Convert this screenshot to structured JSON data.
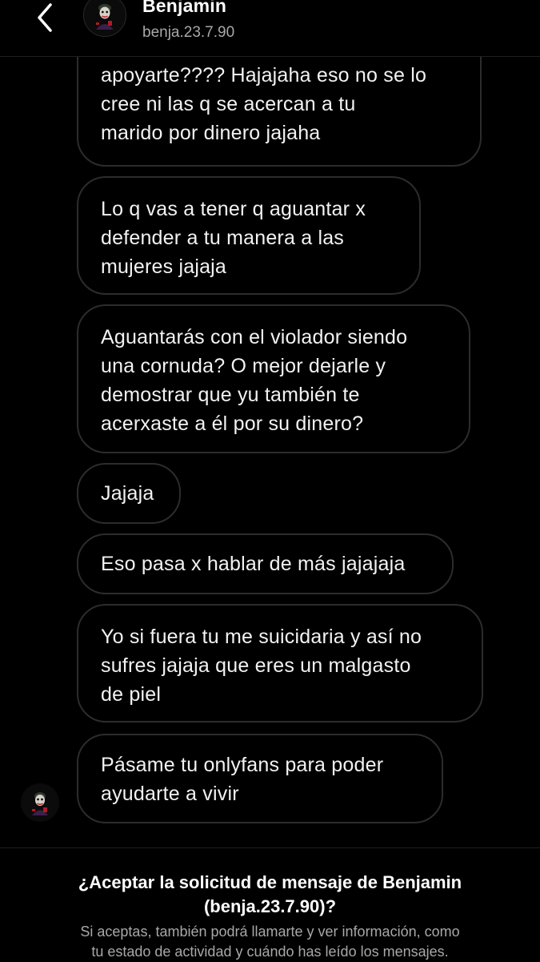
{
  "header": {
    "name": "Benjamin",
    "handle": "benja.23.7.90",
    "back_icon": "chevron-left-icon",
    "avatar_icon": "joker-avatar"
  },
  "messages": [
    {
      "lines": [
        "apoyarte???? Hajajaha eso no se lo",
        "cree ni las q se acercan a tu",
        "marido por dinero jajaha"
      ]
    },
    {
      "lines": [
        "Lo q vas a tener q aguantar x",
        "defender a tu manera a las",
        "mujeres jajaja"
      ]
    },
    {
      "lines": [
        "Aguantarás con el violador siendo",
        "una cornuda? O mejor dejarle y",
        "demostrar que yu también te",
        "acerxaste a él por su dinero?"
      ]
    },
    {
      "lines": [
        "Jajaja"
      ]
    },
    {
      "lines": [
        "Eso pasa x hablar de más jajajaja"
      ]
    },
    {
      "lines": [
        "Yo si fuera tu me suicidaria y así no",
        "sufres jajaja que eres un malgasto",
        "de piel"
      ]
    },
    {
      "lines": [
        "Pásame tu onlyfans para poder",
        "ayudarte a vivir"
      ]
    }
  ],
  "request": {
    "title_lines": [
      "¿Aceptar la solicitud de mensaje de Benjamin",
      "(benja.23.7.90)?"
    ],
    "subtitle_lines": [
      "Si aceptas, también podrá llamarte y ver información, como",
      "tu estado de actividad y cuándo has leído los mensajes."
    ]
  },
  "colors": {
    "background": "#000000",
    "bubble_border": "#2c2c2c",
    "text": "#f2f2f2",
    "secondary_text": "#a8a8a8"
  }
}
